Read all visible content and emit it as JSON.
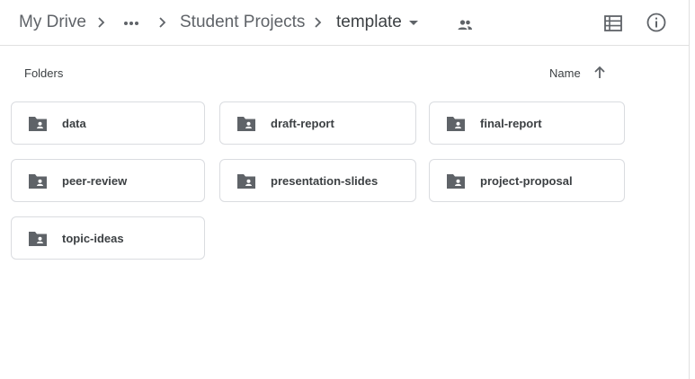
{
  "breadcrumb": {
    "root": "My Drive",
    "middle": "Student Projects",
    "current": "template"
  },
  "section": {
    "title": "Folders",
    "sort_label": "Name",
    "sort_direction": "ascending"
  },
  "folders": [
    {
      "label": "data",
      "icon": "shared-folder-icon"
    },
    {
      "label": "draft-report",
      "icon": "shared-folder-icon"
    },
    {
      "label": "final-report",
      "icon": "shared-folder-icon"
    },
    {
      "label": "peer-review",
      "icon": "shared-folder-icon"
    },
    {
      "label": "presentation-slides",
      "icon": "shared-folder-icon"
    },
    {
      "label": "project-proposal",
      "icon": "shared-folder-icon"
    },
    {
      "label": "topic-ideas",
      "icon": "shared-folder-icon"
    }
  ],
  "colors": {
    "icon": "#5f6368",
    "text": "#3c4043",
    "border": "#dadce0"
  }
}
